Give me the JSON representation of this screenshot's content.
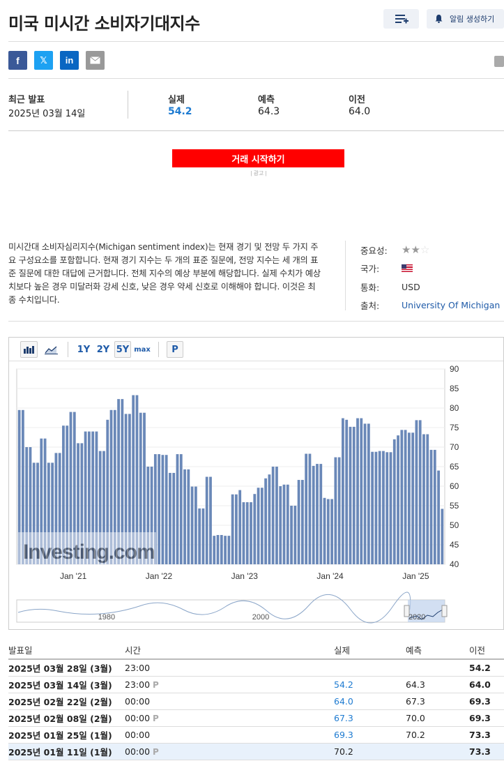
{
  "header": {
    "title": "미국 미시간 소비자기대지수",
    "alert_label": "알림 생성하기"
  },
  "release": {
    "latest_label": "최근 발표",
    "latest_date": "2025년 03월 14일",
    "actual_label": "실제",
    "actual": "54.2",
    "forecast_label": "예측",
    "forecast": "64.3",
    "previous_label": "이전",
    "previous": "64.0"
  },
  "cta": {
    "label": "거래 시작하기",
    "ad_label": "| 광고 |"
  },
  "description": "미시간대 소비자심리지수(Michigan sentiment index)는 현재 경기 및 전망 두 가지 주요 구성요소를 포함합니다. 현재 경기 지수는 두 개의 표준 질문에, 전망 지수는 세 개의 표준 질문에 대한 대답에 근거합니다. 전체 지수의 예상 부분에 해당합니다. 실제 수치가 예상치보다 높은 경우 미달러화 강세 신호, 낮은 경우 약세 신호로 이해해야 합니다. 이것은 최종 수치입니다.",
  "meta": {
    "importance_label": "중요성:",
    "importance_stars": 2,
    "country_label": "국가:",
    "currency_label": "통화:",
    "currency": "USD",
    "source_label": "출처:",
    "source": "University Of Michigan"
  },
  "toolbar": {
    "range_1y": "1Y",
    "range_2y": "2Y",
    "range_5y": "5Y",
    "range_max": "max",
    "p_label": "P"
  },
  "chart_data": {
    "type": "bar",
    "y_ticks": [
      40,
      45,
      50,
      55,
      60,
      65,
      70,
      75,
      80,
      85,
      90
    ],
    "ylim": [
      40,
      90
    ],
    "x_ticks": [
      "Jan '21",
      "Jan '22",
      "Jan '23",
      "Jan '24",
      "Jan '25"
    ],
    "navigator_ticks": [
      "1980",
      "2000",
      "2020"
    ],
    "watermark": "Investing.com",
    "series": [
      {
        "values": [
          79.5,
          79.5,
          70.0,
          70.0,
          66.0,
          66.0,
          72.2,
          72.2,
          66.0,
          66.0,
          68.5,
          68.5,
          75.5,
          75.5,
          79.0,
          79.0,
          71.0,
          71.0,
          74.0,
          74.0,
          74.0,
          74.0,
          69.0,
          69.0,
          77.0,
          79.5,
          79.5,
          82.3,
          82.3,
          78.5,
          78.5,
          83.3,
          83.3,
          78.8,
          78.8,
          65.0,
          65.0,
          68.2,
          68.2,
          68.0,
          68.0,
          63.4,
          63.4,
          68.2,
          68.2,
          64.3,
          64.3,
          59.9,
          59.9,
          54.3,
          54.3,
          62.4,
          62.4,
          47.3,
          47.5,
          47.5,
          47.3,
          47.3,
          57.9,
          57.9,
          59.0,
          55.9,
          55.9,
          55.9,
          58.0,
          59.6,
          59.6,
          62.0,
          63.0,
          65.0,
          65.0,
          60.0,
          60.4,
          60.4,
          55.0,
          55.0,
          61.6,
          61.6,
          68.3,
          68.3,
          65.2,
          65.7,
          65.7,
          57.0,
          56.7,
          56.7,
          67.4,
          67.4,
          77.4,
          77.0,
          75.2,
          75.2,
          77.4,
          77.4,
          76.0,
          76.0,
          68.8,
          68.8,
          69.0,
          69.0,
          68.7,
          68.7,
          72.0,
          73.0,
          74.4,
          74.4,
          73.7,
          73.7,
          76.9,
          76.9,
          73.3,
          73.3,
          69.3,
          69.3,
          64.0,
          54.2
        ]
      }
    ]
  },
  "table": {
    "headers": {
      "date": "발표일",
      "time": "시간",
      "actual": "실제",
      "forecast": "예측",
      "previous": "이전"
    },
    "rows": [
      {
        "date": "2025년 03월 28일 (3월)",
        "time": "23:00",
        "actual": "",
        "forecast": "",
        "previous": "54.2"
      },
      {
        "date": "2025년 03월 14일 (3월)",
        "time": "23:00",
        "actual": "54.2",
        "forecast": "64.3",
        "previous": "64.0"
      },
      {
        "date": "2025년 02월 22일 (2월)",
        "time": "00:00",
        "actual": "64.0",
        "forecast": "67.3",
        "previous": "69.3"
      },
      {
        "date": "2025년 02월 08일 (2월)",
        "time": "00:00",
        "actual": "67.3",
        "forecast": "70.0",
        "previous": "69.3"
      },
      {
        "date": "2025년 01월 25일 (1월)",
        "time": "00:00",
        "actual": "69.3",
        "forecast": "70.2",
        "previous": "73.3"
      },
      {
        "date": "2025년 01월 11일 (1월)",
        "time": "00:00",
        "actual": "70.2",
        "forecast": "",
        "previous": "73.3"
      }
    ]
  }
}
